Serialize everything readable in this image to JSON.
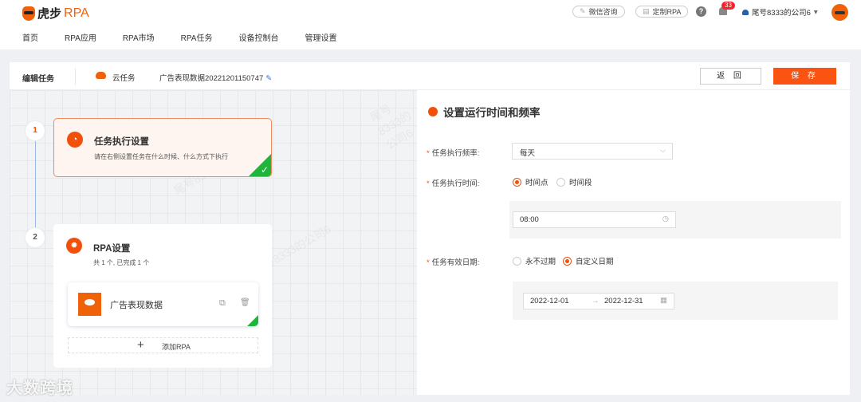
{
  "header": {
    "logo_text_1": "虎步",
    "logo_text_2": "RPA",
    "wechat_label": "微信咨询",
    "custom_label": "定制RPA",
    "help": "?",
    "notif_count": "33",
    "company": "尾号8333的公司6",
    "company_caret": "▾"
  },
  "nav": [
    "首页",
    "RPA应用",
    "RPA市场",
    "RPA任务",
    "设备控制台",
    "管理设置"
  ],
  "editbar": {
    "title": "编辑任务",
    "type": "云任务",
    "task_name": "广告表现数据20221201150747",
    "back": "返 回",
    "save": "保 存"
  },
  "steps": [
    {
      "num": "1",
      "title": "任务执行设置",
      "desc": "请在右侧设置任务在什么时候、什么方式下执行"
    },
    {
      "num": "2",
      "title": "RPA设置",
      "desc": "共 1 个, 已完成 1 个",
      "rpa_name": "广告表现数据",
      "add_label": "添加RPA"
    }
  ],
  "panel": {
    "title": "设置运行时间和频率",
    "freq_label": "任务执行频率:",
    "freq_value": "每天",
    "time_label": "任务执行时间:",
    "time_opt1": "时间点",
    "time_opt2": "时间段",
    "time_value": "08:00",
    "valid_label": "任务有效日期:",
    "valid_opt1": "永不过期",
    "valid_opt2": "自定义日期",
    "date_start": "2022-12-01",
    "date_sep": "→",
    "date_end": "2022-12-31"
  },
  "watermark": {
    "text": "尾号8333的公司6",
    "brand": "大数跨境"
  },
  "colors": {
    "accent": "#fa5312",
    "success": "#1fb53a"
  }
}
